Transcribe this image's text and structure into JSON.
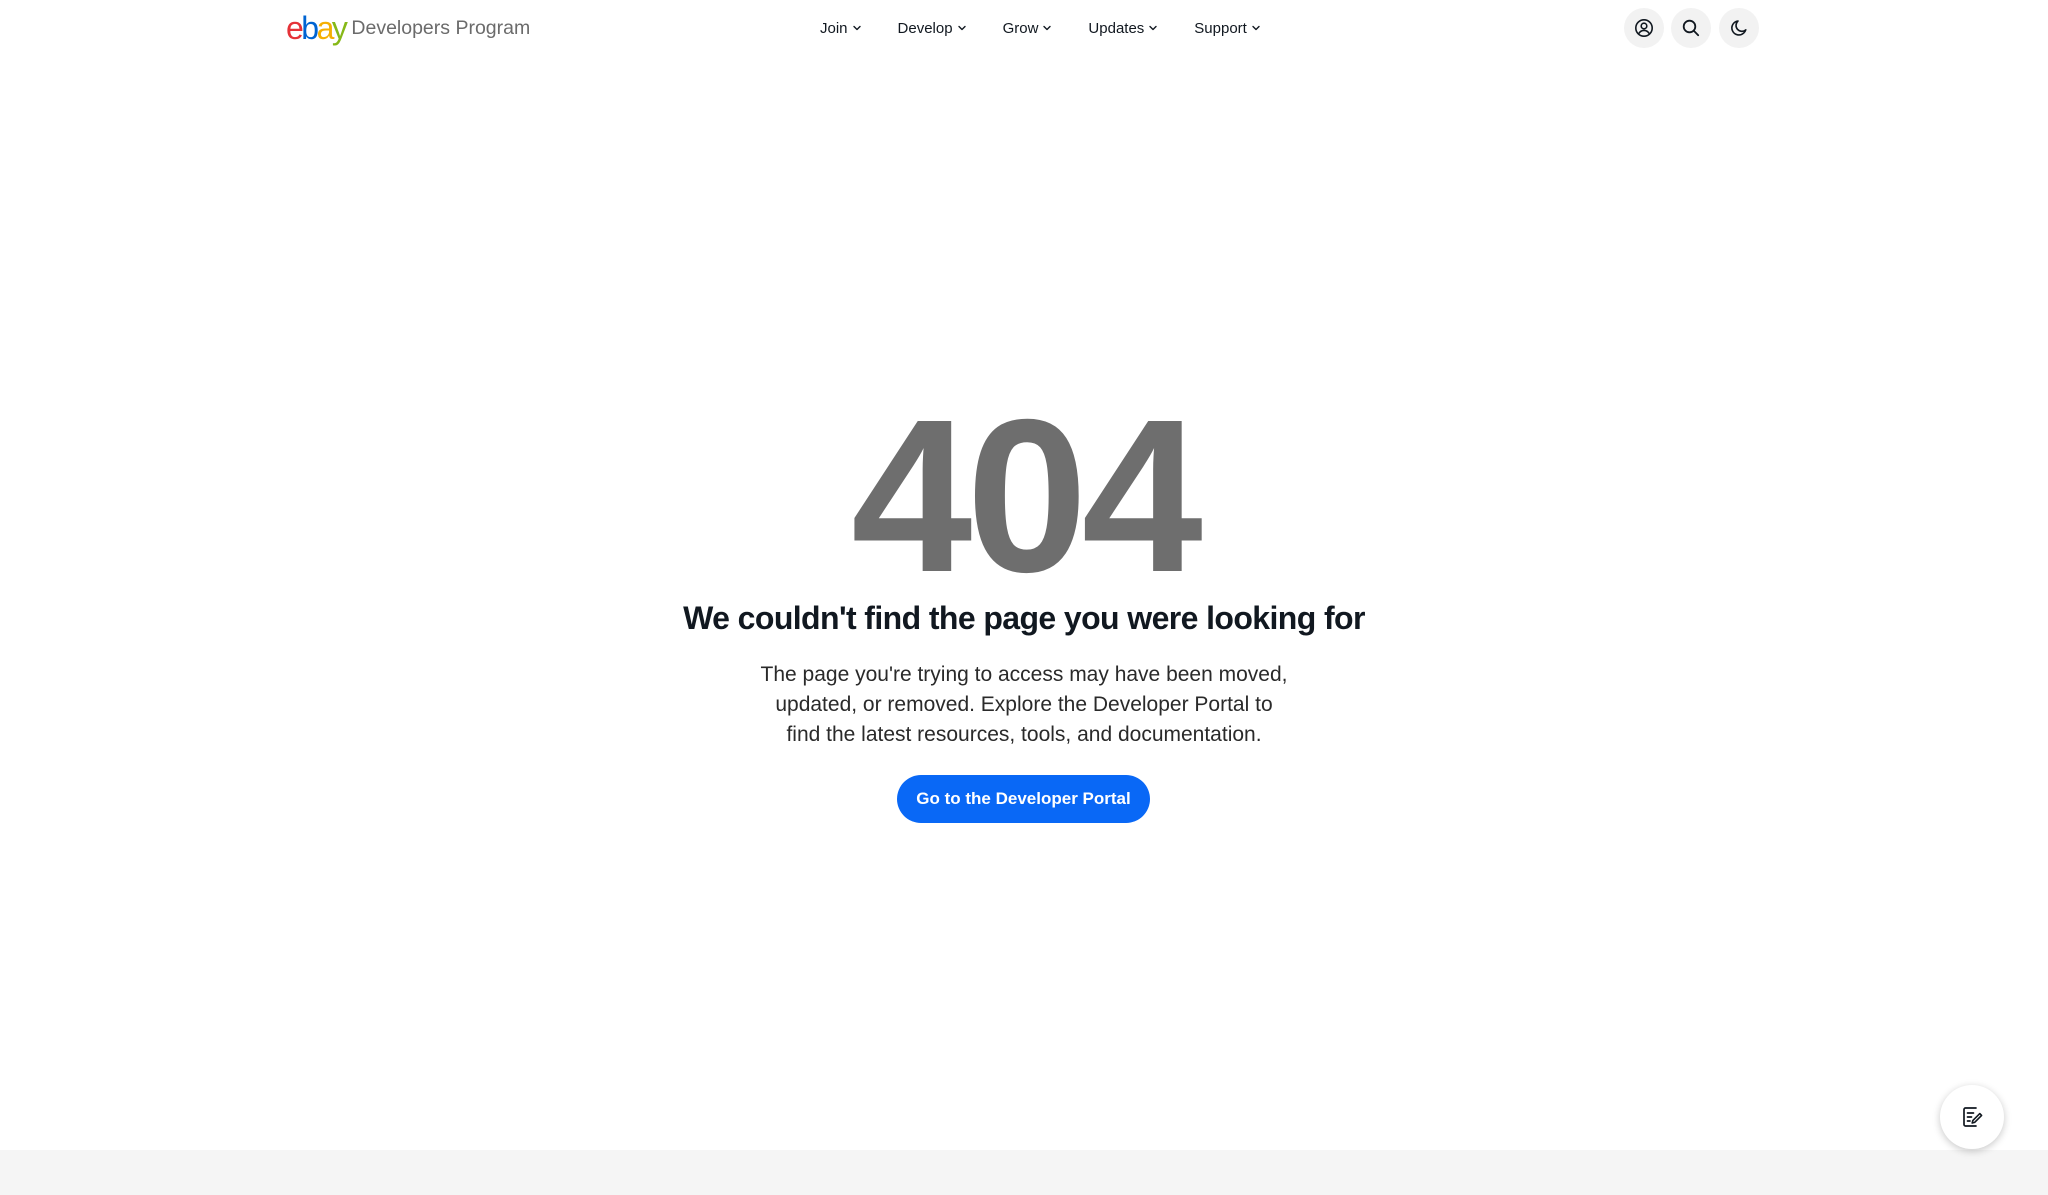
{
  "header": {
    "logo": {
      "letters": [
        "e",
        "b",
        "a",
        "y"
      ],
      "colors": [
        "#e53238",
        "#0064d2",
        "#f5af02",
        "#86b817"
      ],
      "product": "Developers Program"
    },
    "nav": [
      {
        "label": "Join",
        "icon": "chevron-down-icon"
      },
      {
        "label": "Develop",
        "icon": "chevron-down-icon"
      },
      {
        "label": "Grow",
        "icon": "chevron-down-icon"
      },
      {
        "label": "Updates",
        "icon": "chevron-down-icon"
      },
      {
        "label": "Support",
        "icon": "chevron-down-icon"
      }
    ],
    "actions": [
      {
        "icon": "user-account-icon"
      },
      {
        "icon": "search-icon"
      },
      {
        "icon": "moon-icon"
      }
    ]
  },
  "main": {
    "error_code": "404",
    "title": "We couldn't find the page you were looking for",
    "description_lines": [
      "The page you're trying to access may have been moved,",
      "updated, or removed. Explore the Developer Portal to",
      "find the latest resources, tools, and documentation."
    ],
    "cta_label": "Go to the Developer Portal"
  },
  "feedback": {
    "icon": "feedback-edit-icon"
  },
  "colors": {
    "accent": "#0968f6",
    "error_code": "#6e6e6e",
    "text": "#111820",
    "icon_button_bg": "#f2f2f2",
    "footer_bg": "#f5f5f5"
  }
}
